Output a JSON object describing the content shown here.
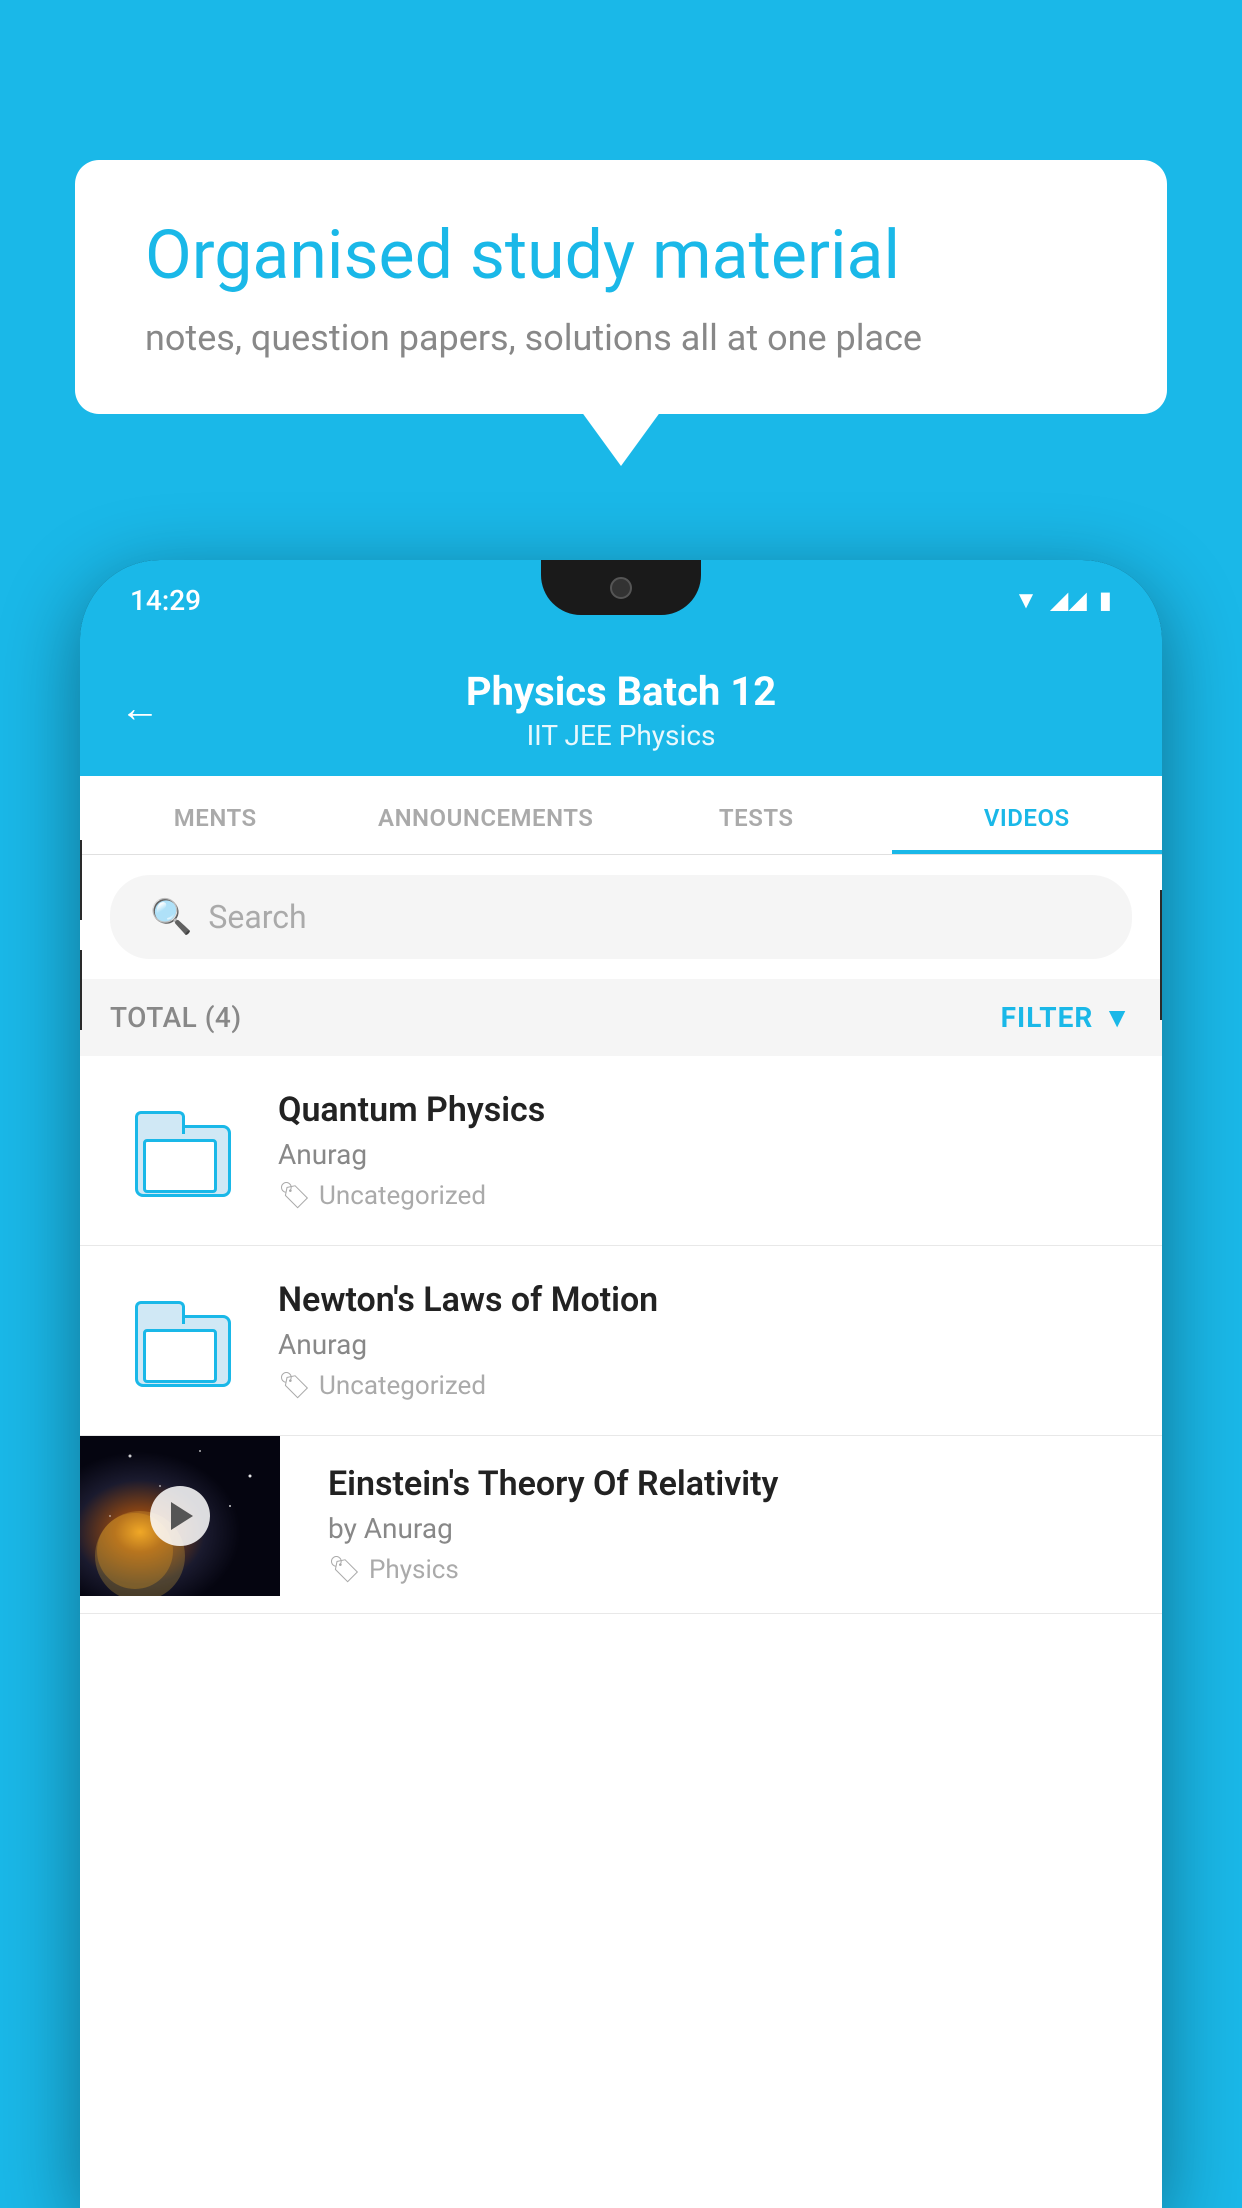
{
  "background": {
    "color": "#1ab8e8"
  },
  "speech_bubble": {
    "title": "Organised study material",
    "subtitle": "notes, question papers, solutions all at one place"
  },
  "phone": {
    "status_bar": {
      "time": "14:29",
      "wifi": "▼",
      "signal": "▲",
      "battery": "▮"
    },
    "header": {
      "back_label": "←",
      "title": "Physics Batch 12",
      "subtitle": "IIT JEE   Physics"
    },
    "tabs": [
      {
        "label": "MENTS",
        "active": false
      },
      {
        "label": "ANNOUNCEMENTS",
        "active": false
      },
      {
        "label": "TESTS",
        "active": false
      },
      {
        "label": "VIDEOS",
        "active": true
      }
    ],
    "search": {
      "placeholder": "Search"
    },
    "filter_bar": {
      "total_label": "TOTAL (4)",
      "filter_label": "FILTER"
    },
    "videos": [
      {
        "title": "Quantum Physics",
        "author": "Anurag",
        "tag": "Uncategorized",
        "type": "folder",
        "has_thumbnail": false
      },
      {
        "title": "Newton's Laws of Motion",
        "author": "Anurag",
        "tag": "Uncategorized",
        "type": "folder",
        "has_thumbnail": false
      },
      {
        "title": "Einstein's Theory Of Relativity",
        "author": "by Anurag",
        "tag": "Physics",
        "type": "video",
        "has_thumbnail": true
      }
    ]
  }
}
